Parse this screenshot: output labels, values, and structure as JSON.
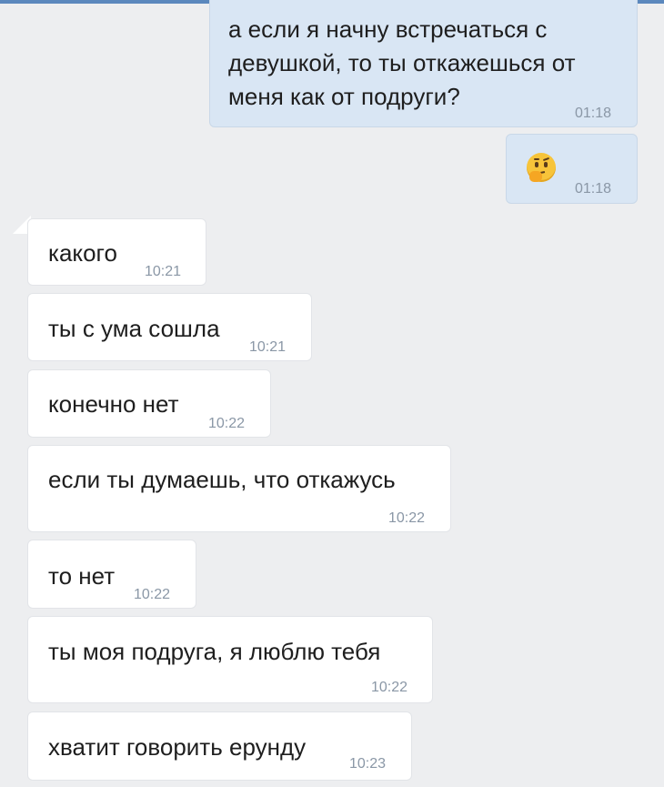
{
  "colors": {
    "out_bubble": "#d9e6f4",
    "in_bubble": "#ffffff",
    "background": "#edeef0",
    "time": "#8a97a6"
  },
  "messages": [
    {
      "direction": "out",
      "text": "а если я начну встречаться с девушкой, то ты откажешься от меня как от подруги?",
      "line1": "а если я начну встречаться с",
      "line2": "девушкой, то ты откажешься от",
      "line3": "меня как от подруги?",
      "time": "01:18"
    },
    {
      "direction": "out",
      "emoji": "thinking-face",
      "time": "01:18"
    },
    {
      "direction": "in",
      "text": "какого",
      "time": "10:21"
    },
    {
      "direction": "in",
      "text": "ты с ума сошла",
      "time": "10:21"
    },
    {
      "direction": "in",
      "text": "конечно нет",
      "time": "10:22"
    },
    {
      "direction": "in",
      "text": "если ты думаешь, что откажусь",
      "time": "10:22"
    },
    {
      "direction": "in",
      "text": "то нет",
      "time": "10:22"
    },
    {
      "direction": "in",
      "text": "ты моя подруга, я люблю тебя",
      "time": "10:22"
    },
    {
      "direction": "in",
      "text": "хватит говорить ерунду",
      "time": "10:23"
    }
  ]
}
